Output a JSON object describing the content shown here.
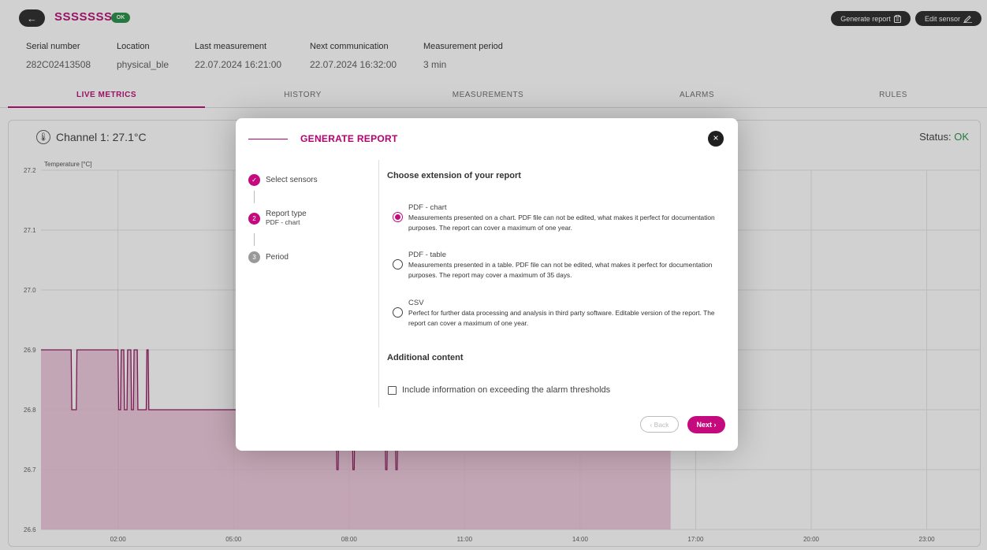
{
  "header": {
    "back_icon": "arrow-left-icon",
    "back_glyph": "←",
    "sensor_name": "SSSSSSSS",
    "status_badge": "OK",
    "generate_report": "Generate report",
    "generate_icon": "clipboard-icon",
    "edit_sensor": "Edit sensor",
    "edit_icon": "pencil-icon"
  },
  "info": [
    {
      "label": "Serial number",
      "value": "282C02413508"
    },
    {
      "label": "Location",
      "value": "physical_ble"
    },
    {
      "label": "Last measurement",
      "value": "22.07.2024 16:21:00"
    },
    {
      "label": "Next communication",
      "value": "22.07.2024 16:32:00"
    },
    {
      "label": "Measurement period",
      "value": "3 min"
    }
  ],
  "tabs": [
    {
      "label": "LIVE METRICS",
      "active": true
    },
    {
      "label": "HISTORY",
      "active": false
    },
    {
      "label": "MEASUREMENTS",
      "active": false
    },
    {
      "label": "ALARMS",
      "active": false
    },
    {
      "label": "RULES",
      "active": false
    }
  ],
  "card": {
    "channel": "Channel 1: 27.1°C",
    "status_label": "Status:",
    "status_value": "OK"
  },
  "chart_data": {
    "type": "line",
    "ylabel": "Temperature [°C]",
    "ylim": [
      26.6,
      27.2
    ],
    "yticks": [
      "27.2",
      "27.1",
      "27.0",
      "26.9",
      "26.8",
      "26.7",
      "26.6"
    ],
    "xticks": [
      "02:00",
      "05:00",
      "08:00",
      "11:00",
      "14:00",
      "17:00",
      "20:00",
      "23:00"
    ],
    "series": [
      {
        "color": "#8b0a55",
        "fill": "#e6b3cd",
        "points": [
          [
            "00:00",
            26.9
          ],
          [
            "00:47",
            26.9
          ],
          [
            "00:48",
            26.8
          ],
          [
            "00:55",
            26.8
          ],
          [
            "00:56",
            26.9
          ],
          [
            "02:00",
            26.9
          ],
          [
            "02:01",
            26.8
          ],
          [
            "02:04",
            26.8
          ],
          [
            "02:05",
            26.9
          ],
          [
            "02:09",
            26.9
          ],
          [
            "02:10",
            26.8
          ],
          [
            "02:14",
            26.8
          ],
          [
            "02:15",
            26.9
          ],
          [
            "02:20",
            26.9
          ],
          [
            "02:21",
            26.8
          ],
          [
            "02:24",
            26.8
          ],
          [
            "02:25",
            26.9
          ],
          [
            "02:30",
            26.9
          ],
          [
            "02:31",
            26.8
          ],
          [
            "02:44",
            26.8
          ],
          [
            "02:45",
            26.9
          ],
          [
            "02:47",
            26.9
          ],
          [
            "02:48",
            26.8
          ],
          [
            "07:40",
            26.8
          ],
          [
            "07:41",
            26.7
          ],
          [
            "07:43",
            26.7
          ],
          [
            "07:44",
            26.8
          ],
          [
            "08:05",
            26.8
          ],
          [
            "08:06",
            26.7
          ],
          [
            "08:08",
            26.7
          ],
          [
            "08:09",
            26.8
          ],
          [
            "08:56",
            26.8
          ],
          [
            "08:57",
            26.7
          ],
          [
            "08:59",
            26.7
          ],
          [
            "09:00",
            26.8
          ],
          [
            "09:12",
            26.8
          ],
          [
            "09:13",
            26.7
          ],
          [
            "09:15",
            26.7
          ],
          [
            "09:16",
            26.8
          ],
          [
            "16:21",
            26.8
          ]
        ]
      }
    ]
  },
  "modal": {
    "title": "GENERATE REPORT",
    "close_icon": "close-icon",
    "close_glyph": "×",
    "steps": [
      {
        "label": "Select sensors",
        "sub": "",
        "state": "done",
        "badge": "✓"
      },
      {
        "label": "Report type",
        "sub": "PDF - chart",
        "state": "active",
        "badge": "2"
      },
      {
        "label": "Period",
        "sub": "",
        "state": "pending",
        "badge": "3"
      }
    ],
    "extension_heading": "Choose extension of your report",
    "options": [
      {
        "title": "PDF - chart",
        "desc": "Measurements presented on a chart. PDF file can not be edited, what makes it perfect for documentation purposes. The report can cover a maximum of one year.",
        "checked": true
      },
      {
        "title": "PDF - table",
        "desc": "Measurements presented in a table. PDF file can not be edited, what makes it perfect for documentation purposes. The report may cover a maximum of 35 days.",
        "checked": false
      },
      {
        "title": "CSV",
        "desc": "Perfect for further data processing and analysis in third party software. Editable version of the report. The report can cover a maximum of one year.",
        "checked": false
      }
    ],
    "additional_heading": "Additional content",
    "checkbox_label": "Include information on exceeding the alarm thresholds",
    "back_label": "‹ Back",
    "next_label": "Next ›"
  }
}
